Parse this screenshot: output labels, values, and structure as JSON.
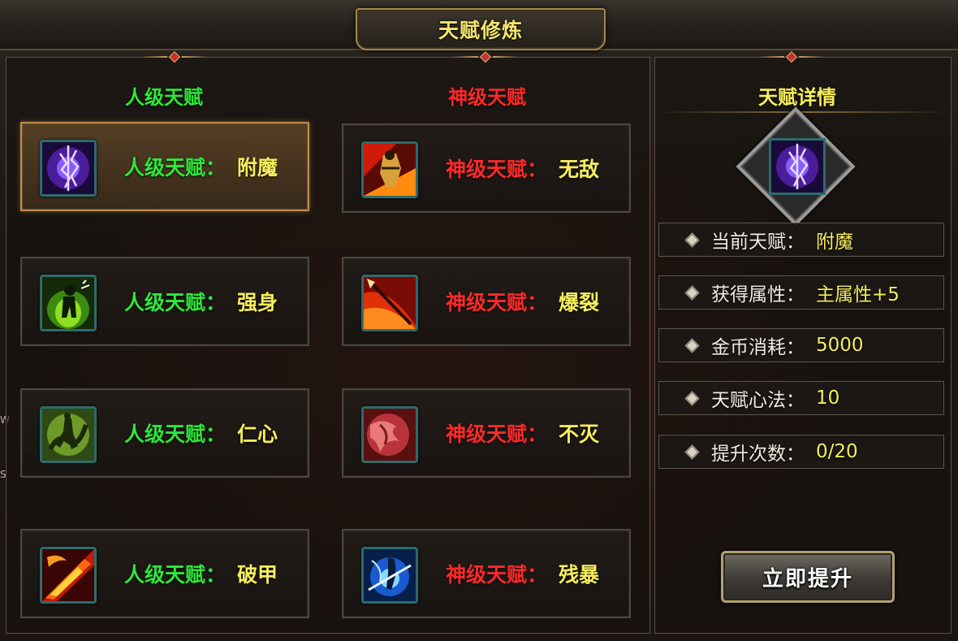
{
  "window": {
    "title": "天赋修炼"
  },
  "columns": {
    "human_header": "人级天赋",
    "divine_header": "神级天赋",
    "detail_header": "天赋详情"
  },
  "human_talents": [
    {
      "prefix": "人级天赋：",
      "name": "附魔",
      "icon": "lightning-sword-icon",
      "selected": true
    },
    {
      "prefix": "人级天赋：",
      "name": "强身",
      "icon": "green-aura-figure-icon",
      "selected": false
    },
    {
      "prefix": "人级天赋：",
      "name": "仁心",
      "icon": "dragon-dancer-icon",
      "selected": false
    },
    {
      "prefix": "人级天赋：",
      "name": "破甲",
      "icon": "fire-slash-icon",
      "selected": false
    }
  ],
  "divine_talents": [
    {
      "prefix": "神级天赋：",
      "name": "无敌",
      "icon": "golden-warrior-icon"
    },
    {
      "prefix": "神级天赋：",
      "name": "爆裂",
      "icon": "fire-spear-icon"
    },
    {
      "prefix": "神级天赋：",
      "name": "不灭",
      "icon": "red-beast-icon"
    },
    {
      "prefix": "神级天赋：",
      "name": "残暴",
      "icon": "blue-swordsman-icon"
    }
  ],
  "detail": {
    "icon": "lightning-sword-icon",
    "stats": [
      {
        "label": "当前天赋：",
        "value": "附魔"
      },
      {
        "label": "获得属性：",
        "value": "主属性+5"
      },
      {
        "label": "金币消耗：",
        "value": "5000"
      },
      {
        "label": "天赋心法：",
        "value": "10"
      },
      {
        "label": "提升次数：",
        "value": "0/20"
      }
    ],
    "upgrade_button": "立即提升"
  },
  "side_marks": [
    "W",
    "D",
    "S"
  ],
  "colors": {
    "human": "#2ee83a",
    "divine": "#ff2a2a",
    "value": "#f7ee5c",
    "frame_gold": "#b98e52"
  }
}
